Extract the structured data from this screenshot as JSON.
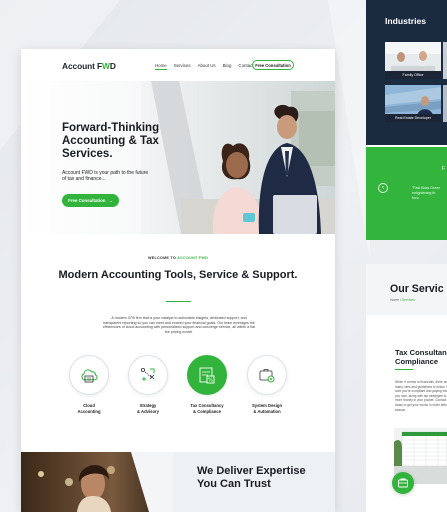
{
  "main": {
    "logo": {
      "text": "Account F",
      "accent": "W",
      "suffix": "D"
    },
    "nav": {
      "links": [
        "Home",
        "Services",
        "About Us",
        "Blog",
        "Contact"
      ],
      "cta": "Free Consultation"
    },
    "hero": {
      "title": "Forward-Thinking Accounting & Tax Services.",
      "subtitle": "Account FWD is your path to the future of tax and finance...",
      "button": "Free Consultation",
      "button_arrow": "→"
    },
    "section": {
      "kicker": "WELCOME TO",
      "kicker_accent": "ACCOUNT FWD",
      "title": "Modern Accounting Tools, Service & Support.",
      "text": "A modern CPA firm that is your catalyst to actionable insights, dedicated support, and transparent reporting so you can meet and exceed your financial goals. Our team leverages the efficiencies of cloud accounting with personalized support and concierge service, all within a flat fee pricing model."
    },
    "services": [
      {
        "icon": "cloud-accounting-icon",
        "label": "Cloud\nAccounting"
      },
      {
        "icon": "strategy-icon",
        "label": "Strategy\n& Advisory"
      },
      {
        "icon": "tax-consultancy-icon",
        "label": "Tax Consultancy\n& Compliance"
      },
      {
        "icon": "system-design-icon",
        "label": "System Design\n& Automation"
      }
    ],
    "bottom": {
      "title": "We Deliver Expertise You Can Trust"
    }
  },
  "industries": {
    "title": "Industries",
    "cards": [
      "Family Office",
      "Real Estate Developer"
    ],
    "quote_title": "F",
    "quote_text": "\"Fast Boss Green\nenlightening th\nfocu"
  },
  "services_panel": {
    "title": "Our Servic",
    "breadcrumb_home": "Home",
    "breadcrumb_sep": "/",
    "breadcrumb_current": "Services",
    "heading": "Tax Consultan Compliance",
    "text": "When it comes to financials, there are many rules and guidelines to follow. Make sure you're compliant and paying what you owe, along with tax strategies to keep more money in your pocket. Contact us today to get your books in order before tax season."
  },
  "colors": {
    "accent": "#32b43c",
    "navy": "#1a2a3f",
    "text": "#1a1c22"
  }
}
